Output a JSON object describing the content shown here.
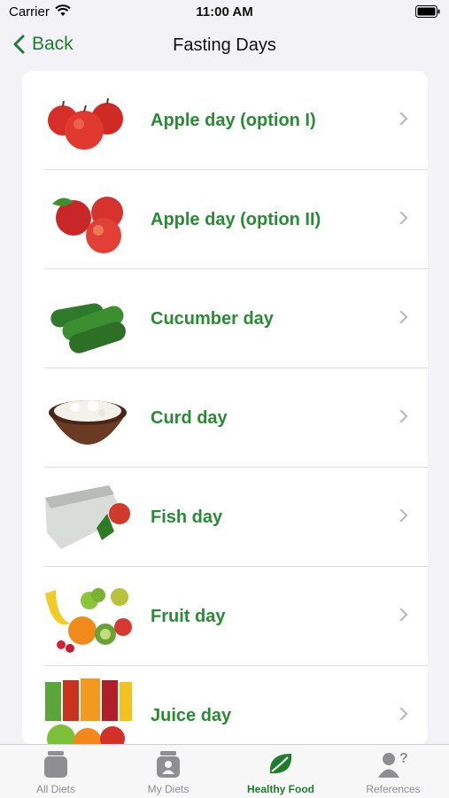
{
  "status_bar": {
    "carrier": "Carrier",
    "time": "11:00 AM"
  },
  "nav": {
    "back_label": "Back",
    "title": "Fasting Days"
  },
  "items": [
    {
      "label": "Apple day (option I)",
      "image": "apples-image"
    },
    {
      "label": "Apple day (option II)",
      "image": "apples-leaf-image"
    },
    {
      "label": "Cucumber day",
      "image": "cucumbers-image"
    },
    {
      "label": "Curd day",
      "image": "curd-bowl-image"
    },
    {
      "label": "Fish day",
      "image": "fish-image"
    },
    {
      "label": "Fruit day",
      "image": "fruits-image"
    },
    {
      "label": "Juice day",
      "image": "juices-image"
    }
  ],
  "tabs": [
    {
      "label": "All Diets",
      "icon": "jar-icon",
      "active": false
    },
    {
      "label": "My Diets",
      "icon": "profile-jar-icon",
      "active": false
    },
    {
      "label": "Healthy Food",
      "icon": "leaf-icon",
      "active": true
    },
    {
      "label": "References",
      "icon": "person-question-icon",
      "active": false
    }
  ],
  "colors": {
    "accent": "#1e7d2e",
    "label_green": "#2a8a36",
    "background": "#f2f2f7"
  }
}
